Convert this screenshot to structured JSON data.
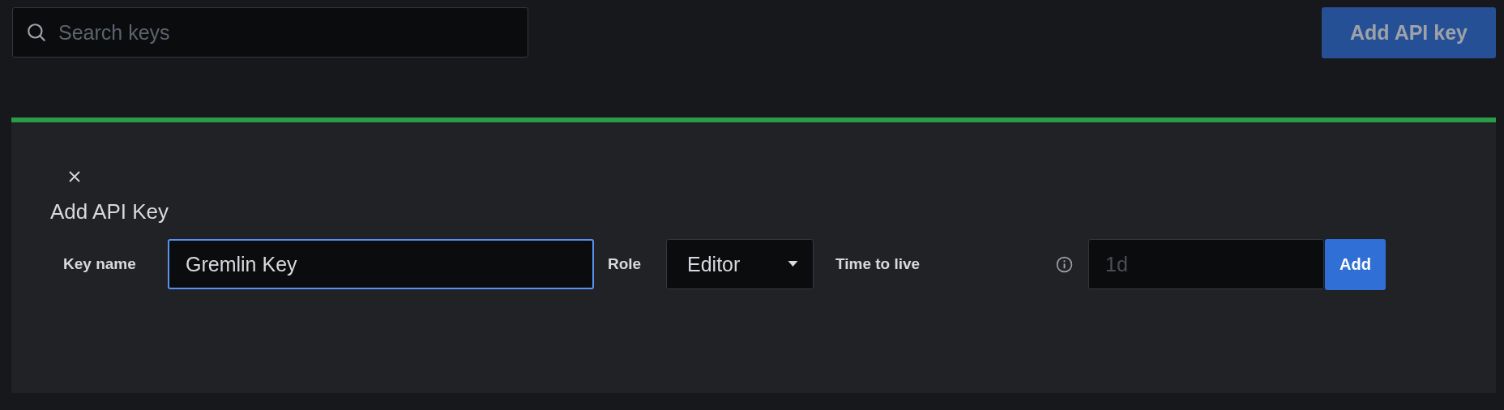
{
  "search": {
    "placeholder": "Search keys"
  },
  "add_api_key_button": {
    "label": "Add API key",
    "disabled": true
  },
  "add_panel": {
    "title": "Add API Key",
    "key_name": {
      "label": "Key name",
      "value": "Gremlin Key",
      "focused": true
    },
    "role": {
      "label": "Role",
      "value": "Editor"
    },
    "time_to_live": {
      "label": "Time to live",
      "placeholder": "1d"
    },
    "submit": {
      "label": "Add"
    }
  }
}
